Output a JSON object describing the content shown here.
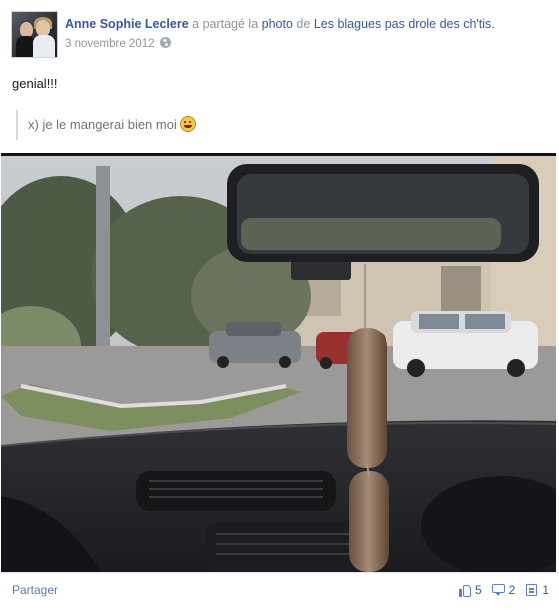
{
  "header": {
    "author": "Anne Sophie Leclere",
    "verb": "a partagé la",
    "object": "photo",
    "preposition": "de",
    "page_name": "Les blagues pas drole des ch'tis.",
    "date": "3 novembre 2012",
    "privacy_icon": "globe-icon",
    "avatar_icon": "profile-picture"
  },
  "post": {
    "message": "genial!!!",
    "quote": "x) je le mangerai bien moi",
    "quote_emoji": "tongue-emoji-icon",
    "photo_icon": "car-dashboard-photo"
  },
  "footer": {
    "share_label": "Partager",
    "likes": "5",
    "comments": "2",
    "shares": "1",
    "icons": [
      "like-icon",
      "comment-icon",
      "share-icon"
    ]
  },
  "colors": {
    "link": "#3b5998",
    "muted": "#8f949b",
    "text": "#141823"
  }
}
